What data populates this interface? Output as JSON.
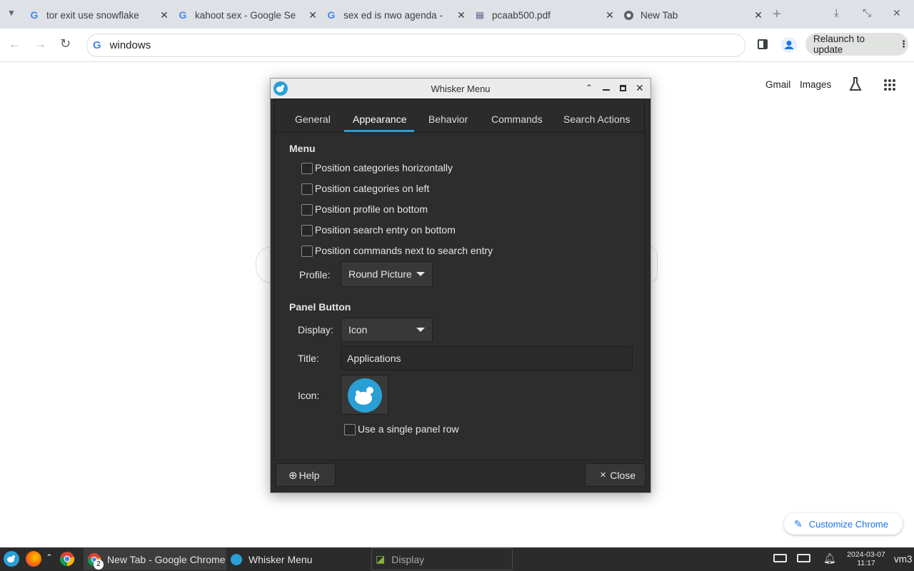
{
  "browser": {
    "tabs": [
      {
        "title": "tor exit use snowflake",
        "favicon": "google-icon"
      },
      {
        "title": "kahoot sex - Google Se",
        "favicon": "google-icon"
      },
      {
        "title": "sex ed is nwo agenda -",
        "favicon": "google-icon"
      },
      {
        "title": "pcaab500.pdf",
        "favicon": "pdf-icon"
      },
      {
        "title": "New Tab",
        "favicon": "chrome-icon"
      }
    ],
    "new_tab_symbol": "+",
    "address": "windows",
    "relaunch_label": "Relaunch to update"
  },
  "page": {
    "gmail": "Gmail",
    "images": "Images",
    "customize": "Customize Chrome"
  },
  "dialog": {
    "title": "Whisker Menu",
    "tabs": [
      "General",
      "Appearance",
      "Behavior",
      "Commands",
      "Search Actions"
    ],
    "active_tab": "Appearance",
    "menu_section": "Menu",
    "menu_options": [
      {
        "label": "Position categories horizontally",
        "checked": false
      },
      {
        "label": "Position categories on left",
        "checked": false
      },
      {
        "label": "Position profile on bottom",
        "checked": false
      },
      {
        "label": "Position search entry on bottom",
        "checked": false
      },
      {
        "label": "Position commands next to search entry",
        "checked": false
      }
    ],
    "profile_label": "Profile:",
    "profile_value": "Round Picture",
    "panel_section": "Panel Button",
    "display_label": "Display:",
    "display_value": "Icon",
    "title_label": "Title:",
    "title_value": "Applications",
    "icon_label": "Icon:",
    "single_row_label": "Use a single panel row",
    "help_label": "Help",
    "close_label": "Close"
  },
  "taskbar": {
    "chrome_count": "2",
    "tasks": [
      "New Tab - Google Chrome",
      "Whisker Menu",
      "Display"
    ],
    "date": "2024-03-07",
    "time": "11:17",
    "user": "vm3"
  },
  "colors": {
    "tabstrip": "#dee1e6",
    "accent_blue": "#1a73e8",
    "xfce_blue": "#2a9fd6",
    "dialog_bg": "#2d2d2d",
    "taskbar_bg": "#2b2b2b"
  }
}
